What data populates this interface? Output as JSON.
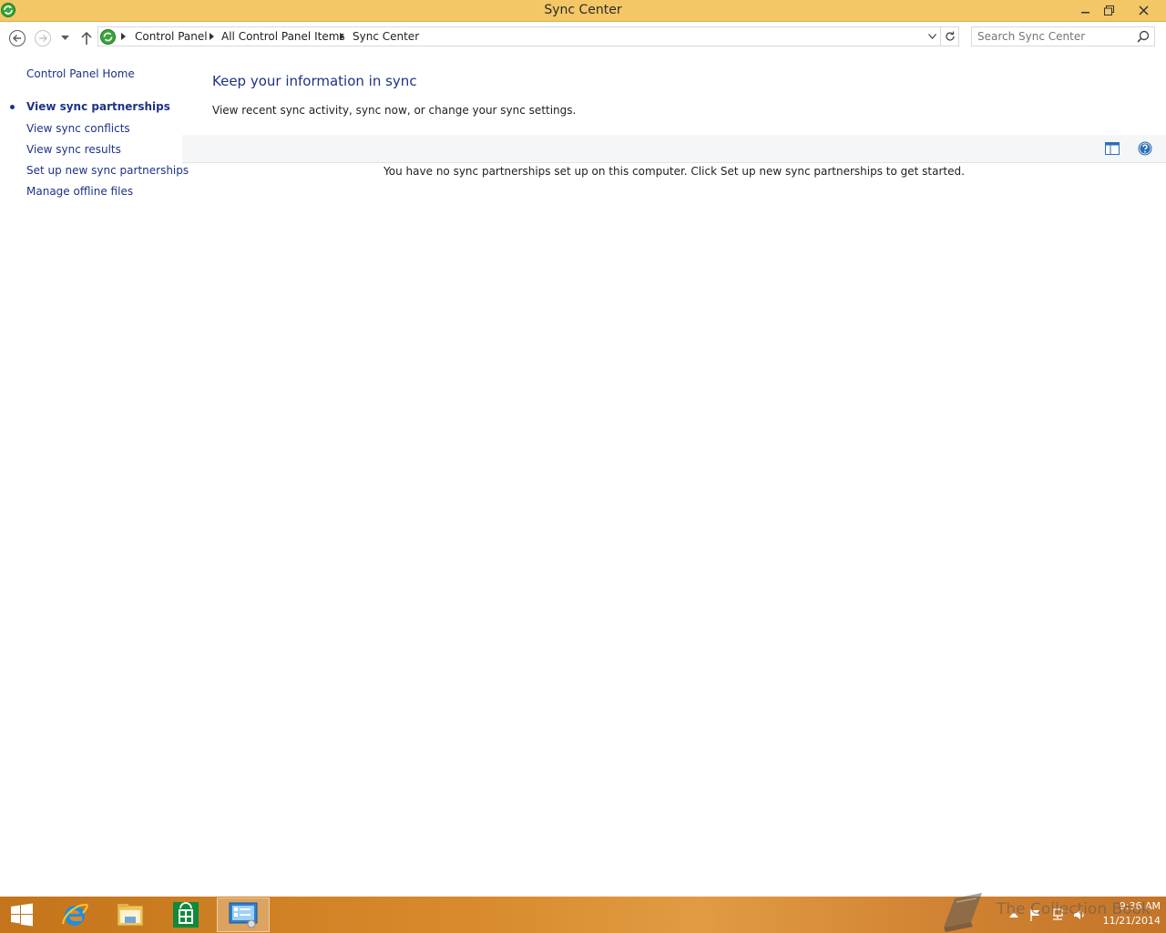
{
  "window": {
    "title": "Sync Center",
    "minimize_label": "–",
    "restore_label": "❐",
    "close_label": "✕"
  },
  "address": {
    "crumbs": [
      "Control Panel",
      "All Control Panel Items",
      "Sync Center"
    ]
  },
  "search": {
    "placeholder": "Search Sync Center"
  },
  "sidebar": {
    "home": "Control Panel Home",
    "items": [
      {
        "label": "View sync partnerships",
        "current": true
      },
      {
        "label": "View sync conflicts"
      },
      {
        "label": "View sync results"
      },
      {
        "label": "Set up new sync partnerships"
      },
      {
        "label": "Manage offline files"
      }
    ]
  },
  "main": {
    "heading": "Keep your information in sync",
    "subtitle": "View recent sync activity, sync now, or change your sync settings.",
    "empty_message": "You have no sync partnerships set up on this computer. Click Set up new sync partnerships to get started."
  },
  "taskbar": {
    "items": [
      "start-icon",
      "internet-explorer-icon",
      "file-explorer-icon",
      "store-icon",
      "control-panel-icon"
    ],
    "clock_time": "9:36 AM",
    "clock_date": "11/21/2014"
  },
  "watermark": {
    "text": "The Collection Book"
  },
  "colors": {
    "titlebar": "#f3c766",
    "link": "#1e3287",
    "taskbar": "#d88a2c"
  }
}
